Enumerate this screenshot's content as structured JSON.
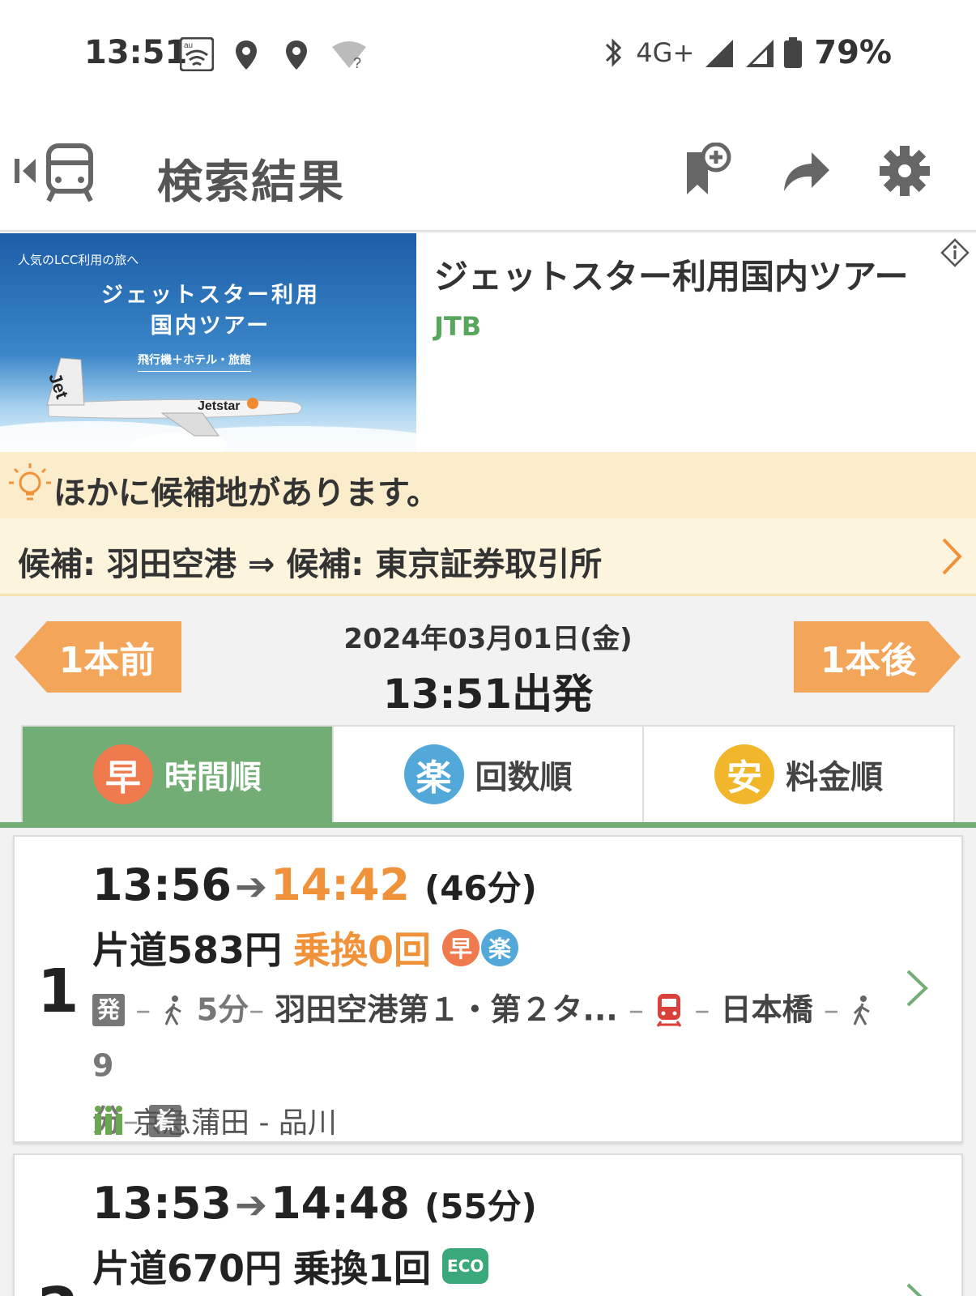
{
  "status_bar": {
    "time": "13:51",
    "carrier_label": "au",
    "network": "4G+",
    "battery": "79%",
    "unknown_wifi_mark": "?"
  },
  "app_bar": {
    "title": "検索結果",
    "icons": [
      "back-train-icon",
      "bookmark-add-icon",
      "share-icon",
      "gear-icon"
    ]
  },
  "ad": {
    "image_copy": "人気のLCC利用の旅へ",
    "image_headline_1": "ジェットスター利用",
    "image_headline_2": "国内ツアー",
    "image_sub": "飛行機＋ホテル・旅館",
    "image_brand": "Jetstar",
    "title": "ジェットスター利用国内ツアー",
    "advertiser": "JTB"
  },
  "candidates": {
    "hint": "ほかに候補地があります。",
    "route": "候補: 羽田空港 ⇒ 候補: 東京証券取引所"
  },
  "date_nav": {
    "prev_label": "1本前",
    "next_label": "1本後",
    "date": "2024年03月01日(金)",
    "time": "13:51出発"
  },
  "sort_tabs": [
    {
      "badge": "早",
      "label": "時間順",
      "active": true
    },
    {
      "badge": "楽",
      "label": "回数順",
      "active": false
    },
    {
      "badge": "安",
      "label": "料金順",
      "active": false
    }
  ],
  "routes": [
    {
      "rank": "1",
      "depart": "13:56",
      "arrive": "14:42",
      "duration": "(46分)",
      "fare": "片道583円",
      "transfers": "乗換0回",
      "badges": [
        "早",
        "楽"
      ],
      "start_tag": "発",
      "walk1": "5分",
      "station1": "羽田空港第１・第２タ...",
      "station2": "日本橋",
      "walk2_a": "9",
      "walk2_b": "分",
      "end_tag": "着",
      "crowd_route": "京急蒲田 - 品川"
    },
    {
      "rank": "2",
      "depart": "13:53",
      "arrive": "14:48",
      "duration": "(55分)",
      "fare": "片道670円",
      "transfers": "乗換1回",
      "eco_badge": "ECO"
    }
  ],
  "colors": {
    "accent_green": "#72ad76",
    "accent_orange": "#f0923a",
    "nav_orange": "#f3a559",
    "badge_fast": "#ef7a4e",
    "badge_easy": "#52a8d8",
    "badge_cheap": "#f2b62b",
    "hint_bg": "#fbeccb",
    "eco_green": "#3aa87a"
  }
}
